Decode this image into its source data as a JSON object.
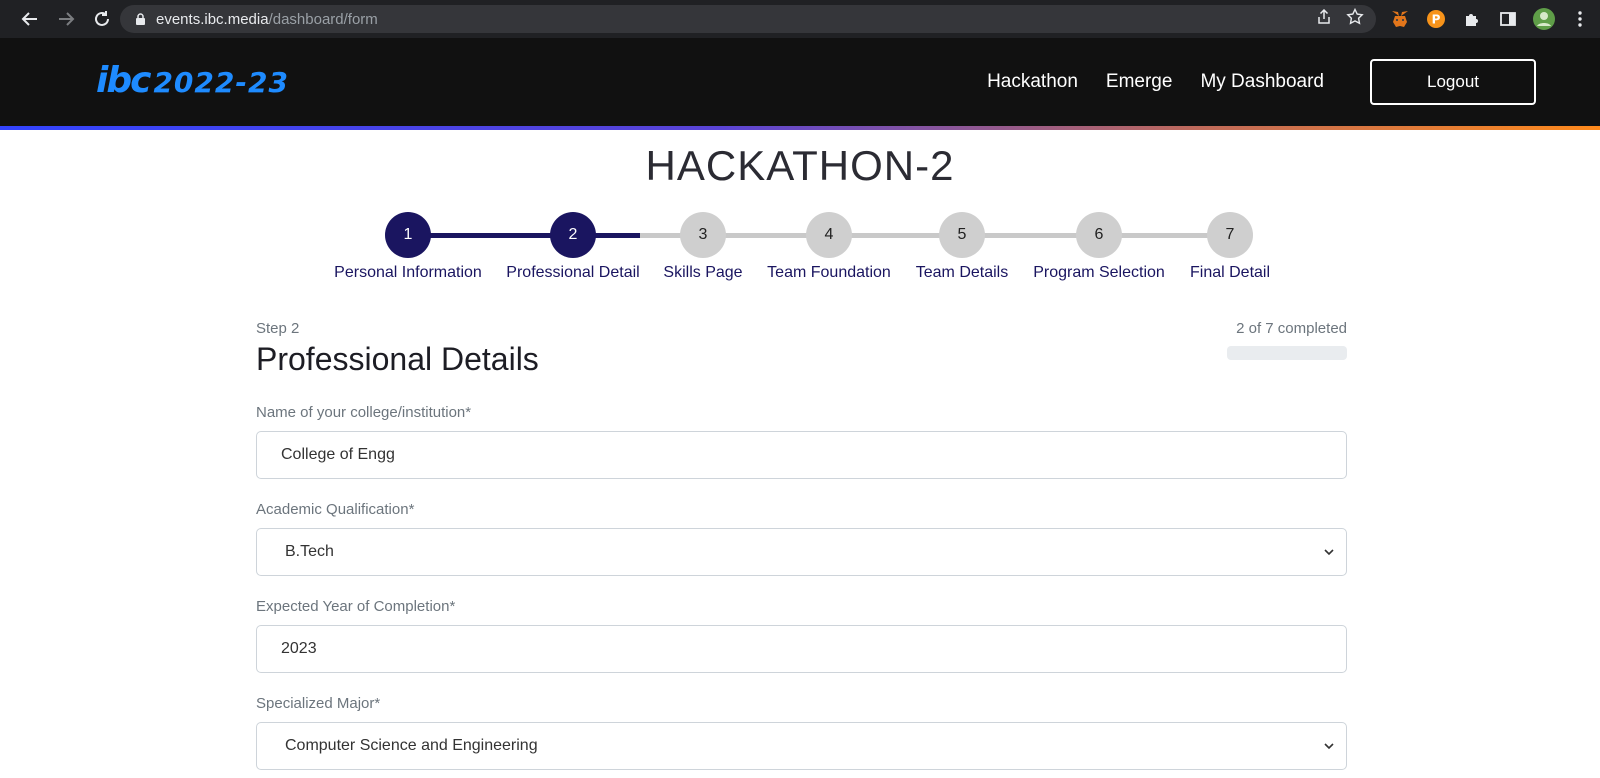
{
  "browser": {
    "url_host": "events.ibc.media",
    "url_path": "/dashboard/form"
  },
  "header": {
    "logo_mark": "ibc",
    "logo_year": "2022-23",
    "nav": [
      "Hackathon",
      "Emerge",
      "My Dashboard"
    ],
    "logout_label": "Logout"
  },
  "page": {
    "title": "HACKATHON-2"
  },
  "stepper": {
    "current": 2,
    "steps": [
      {
        "number": "1",
        "label": "Personal Information"
      },
      {
        "number": "2",
        "label": "Professional Detail"
      },
      {
        "number": "3",
        "label": "Skills Page"
      },
      {
        "number": "4",
        "label": "Team Foundation"
      },
      {
        "number": "5",
        "label": "Team Details"
      },
      {
        "number": "6",
        "label": "Program Selection"
      },
      {
        "number": "7",
        "label": "Final Detail"
      }
    ]
  },
  "form": {
    "step_label": "Step 2",
    "completed_text": "2 of 7 completed",
    "section_title": "Professional Details",
    "fields": {
      "college": {
        "label": "Name of your college/institution*",
        "value": "College of Engg"
      },
      "qualification": {
        "label": "Academic Qualification*",
        "value": "B.Tech"
      },
      "year": {
        "label": "Expected Year of Completion*",
        "value": "2023"
      },
      "major": {
        "label": "Specialized Major*",
        "value": "Computer Science and Engineering"
      }
    }
  },
  "colors": {
    "step_done": "#1a1560",
    "step_todo": "#cfcfcf",
    "logo_blue": "#1e8bff",
    "header_bg": "#111111"
  }
}
